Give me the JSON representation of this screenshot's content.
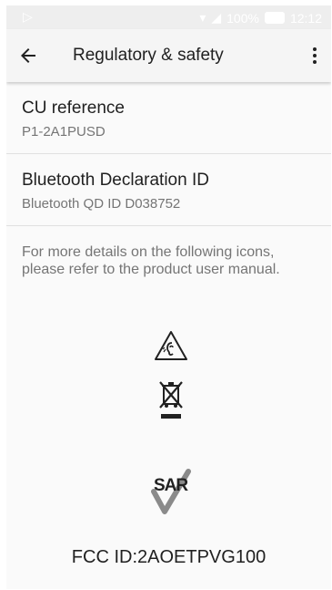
{
  "status_bar": {
    "battery": "100%",
    "time": "12:12"
  },
  "app_bar": {
    "title": "Regulatory & safety"
  },
  "items": [
    {
      "title": "CU reference",
      "subtitle": "P1-2A1PUSD"
    },
    {
      "title": "Bluetooth Declaration ID",
      "subtitle": "Bluetooth QD ID D038752"
    }
  ],
  "note": "For more details on the following icons, please refer to the product user manual.",
  "icons": {
    "hearing": "hearing-warning-icon",
    "weee": "crossed-out-bin-icon",
    "sar_label": "SAR"
  },
  "fcc_id": "FCC ID:2AOETPVG100"
}
